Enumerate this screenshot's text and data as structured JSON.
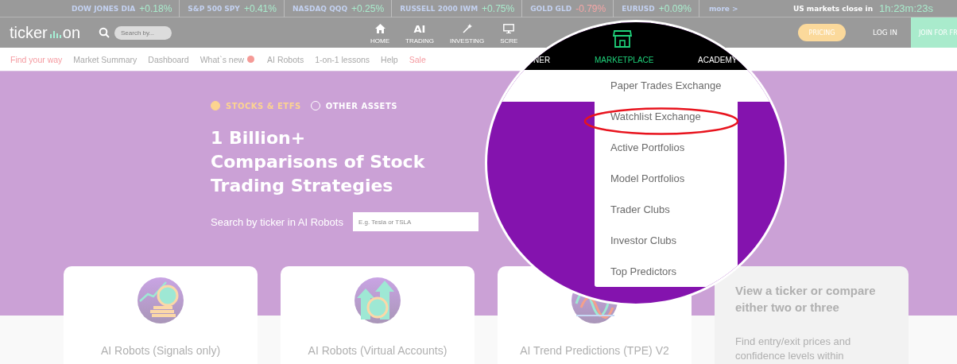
{
  "ticker_bar": {
    "quotes": [
      {
        "name": "DOW JONES DIA",
        "change": "+0.18%",
        "color": "#a9ebcc"
      },
      {
        "name": "S&P 500 SPY",
        "change": "+0.41%",
        "color": "#a9ebcc"
      },
      {
        "name": "NASDAQ QQQ",
        "change": "+0.25%",
        "color": "#a9ebcc"
      },
      {
        "name": "RUSSELL 2000 IWM",
        "change": "+0.75%",
        "color": "#a9ebcc"
      },
      {
        "name": "GOLD GLD",
        "change": "-0.79%",
        "color": "#f5a6a6"
      },
      {
        "name": "EURUSD",
        "change": "+0.09%",
        "color": "#a9ebcc"
      }
    ],
    "more": "more >",
    "close_label": "US markets close in",
    "countdown": "1h:23m:23s"
  },
  "header": {
    "logo_left": "ticker",
    "logo_right": "on",
    "search": {
      "placeholder": "Search by..."
    },
    "nav": [
      {
        "label": "HOME",
        "kind": "home"
      },
      {
        "label": "TRADING",
        "kind": "glyph",
        "glyph": "AI"
      },
      {
        "label": "INVESTING",
        "kind": "wand"
      },
      {
        "label": "SCRE",
        "kind": "monitor"
      }
    ],
    "pricing": "PRICING",
    "login": "LOG IN",
    "join": "JOIN FOR FR"
  },
  "subnav": [
    {
      "label": "Find your way",
      "accent": true,
      "badge": false
    },
    {
      "label": "Market Summary",
      "accent": false,
      "badge": false
    },
    {
      "label": "Dashboard",
      "accent": false,
      "badge": false
    },
    {
      "label": "What`s new",
      "accent": false,
      "badge": true
    },
    {
      "label": "AI Robots",
      "accent": false,
      "badge": false
    },
    {
      "label": "1-on-1 lessons",
      "accent": false,
      "badge": false
    },
    {
      "label": "Help",
      "accent": false,
      "badge": false
    },
    {
      "label": "Sale",
      "accent": true,
      "badge": false
    }
  ],
  "hero": {
    "options": [
      {
        "label": "STOCKS & ETFS",
        "selected": true
      },
      {
        "label": "OTHER ASSETS",
        "selected": false
      }
    ],
    "title_lines": [
      "1 Billion+",
      "Comparisons of Stock",
      "Trading Strategies"
    ],
    "search_label": "Search by ticker in AI Robots",
    "search_placeholder": "E.g. Tesla or TSLA"
  },
  "cards": [
    {
      "kind": "product",
      "title": "AI Robots (Signals only)"
    },
    {
      "kind": "product",
      "title": "AI Robots (Virtual Accounts)"
    },
    {
      "kind": "product",
      "title": "AI Trend Predictions (TPE) V2"
    },
    {
      "kind": "info",
      "title": "View a ticker or compare either two or three",
      "text": "Find entry/exit prices and confidence levels within"
    }
  ],
  "magnifier": {
    "nav": [
      {
        "label": "NER",
        "selected": false
      },
      {
        "label": "MARKETPLACE",
        "selected": true
      },
      {
        "label": "ACADEMY",
        "selected": false
      }
    ],
    "menu": [
      {
        "label": "Paper Trades Exchange",
        "highlighted": false
      },
      {
        "label": "Watchlist Exchange",
        "highlighted": true
      },
      {
        "label": "Active Portfolios",
        "highlighted": false
      },
      {
        "label": "Model Portfolios",
        "highlighted": false
      },
      {
        "label": "Trader Clubs",
        "highlighted": false
      },
      {
        "label": "Investor Clubs",
        "highlighted": false
      },
      {
        "label": "Top Predictors",
        "highlighted": false
      }
    ]
  }
}
